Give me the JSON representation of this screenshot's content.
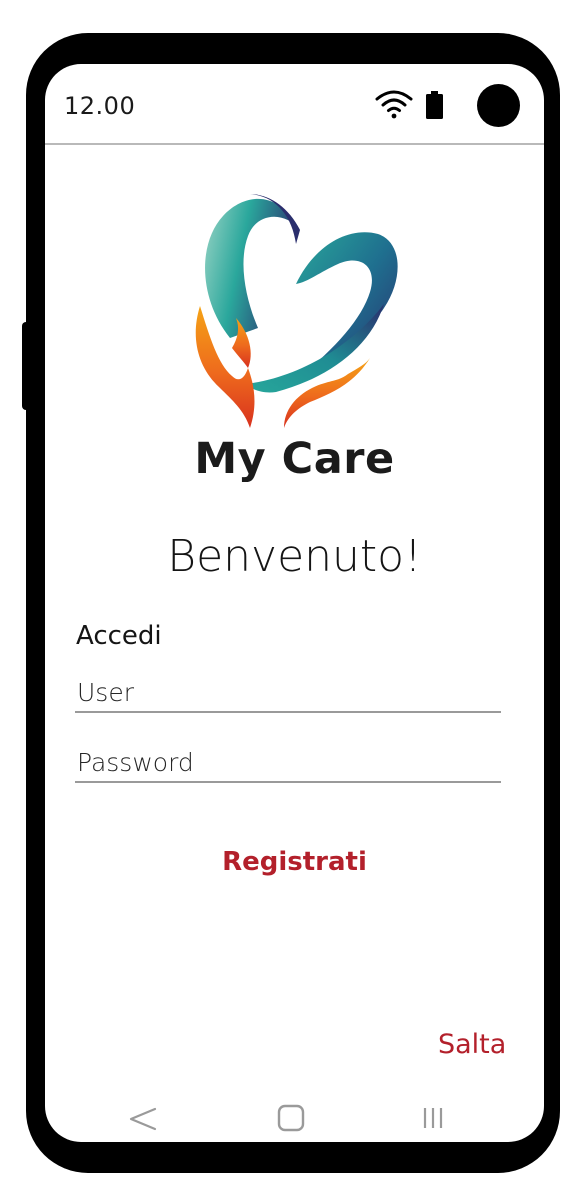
{
  "status_bar": {
    "time": "12.00",
    "icons": [
      "wifi-icon",
      "battery-icon",
      "camera-icon"
    ]
  },
  "logo": {
    "icon": "heart-logo-icon",
    "name": "My Care"
  },
  "welcome": {
    "title": "Benvenuto!"
  },
  "login": {
    "heading": "Accedi",
    "user_placeholder": "User",
    "user_value": "",
    "password_placeholder": "Password",
    "password_value": ""
  },
  "actions": {
    "register_label": "Registrati",
    "skip_label": "Salta"
  },
  "nav_bar": {
    "icons": [
      "back-icon",
      "home-icon",
      "recents-icon"
    ]
  },
  "colors": {
    "accent_red": "#b3202b",
    "logo_teal": "#1f9e97",
    "logo_navy": "#2a2e6d",
    "logo_orange": "#ee6a1d",
    "text": "#151515",
    "divider": "#9a9a9a"
  }
}
